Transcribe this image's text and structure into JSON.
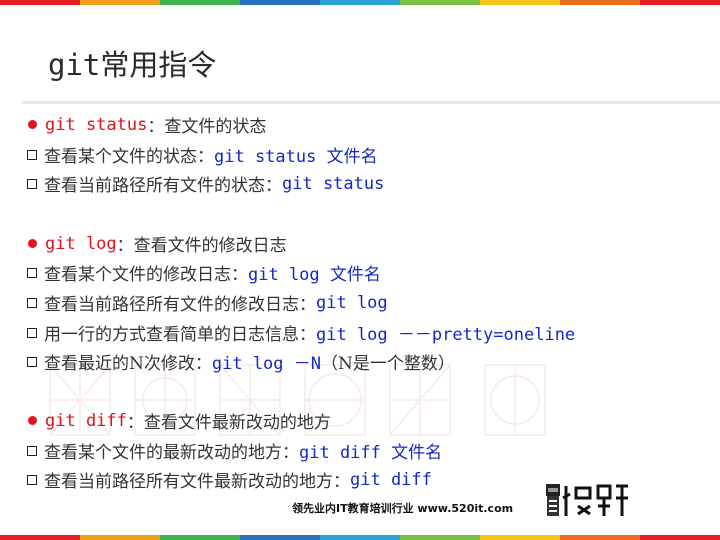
{
  "colors": {
    "stripe": [
      "#e41e25",
      "#f0a01e",
      "#3cb44b",
      "#2a6ebf",
      "#29a3d6",
      "#7ac143",
      "#f6c519",
      "#ea6d1d",
      "#e41e25"
    ],
    "command_red": "#e0121b",
    "command_blue": "#1428c8"
  },
  "title": {
    "prefix": "git",
    "text": "常用指令"
  },
  "sections": [
    {
      "header": {
        "cmd": "git status",
        "desc": " ：查文件的状态"
      },
      "items": [
        {
          "label": "查看某个文件的状态：",
          "cmd": "git status 文件名"
        },
        {
          "label": "查看当前路径所有文件的状态：",
          "cmd": "git status"
        }
      ]
    },
    {
      "header": {
        "cmd": "git log",
        "desc": " ：查看文件的修改日志"
      },
      "items": [
        {
          "label": "查看某个文件的修改日志：",
          "cmd": "git log 文件名"
        },
        {
          "label": "查看当前路径所有文件的修改日志：",
          "cmd": "git log"
        },
        {
          "label": "用一行的方式查看简单的日志信息：",
          "cmd": "git log －－pretty=oneline"
        },
        {
          "label": "查看最近的N次修改：",
          "cmd": "git log －N",
          "suffix": "（N是一个整数）"
        }
      ]
    },
    {
      "header": {
        "cmd": "git diff",
        "desc": " ：查看文件最新改动的地方"
      },
      "items": [
        {
          "label": "查看某个文件的最新改动的地方：",
          "cmd": "git diff 文件名"
        },
        {
          "label": "查看当前路径所有文件最新改动的地方：",
          "cmd": "git diff"
        }
      ]
    }
  ],
  "footer": {
    "text": "领先业内IT教育培训行业 www.520it.com"
  },
  "logo": {
    "icon": "mascot-logo-icon"
  }
}
